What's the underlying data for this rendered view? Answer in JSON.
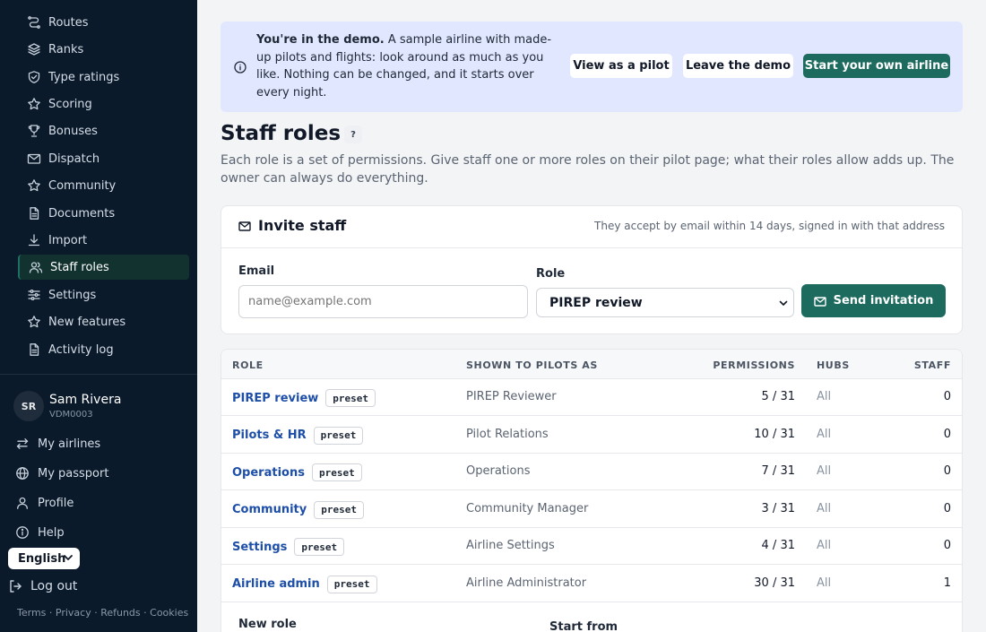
{
  "sidebar": {
    "nav": [
      {
        "label": "Routes",
        "icon": "routes-icon"
      },
      {
        "label": "Ranks",
        "icon": "layers-icon"
      },
      {
        "label": "Type ratings",
        "icon": "shield-icon"
      },
      {
        "label": "Scoring",
        "icon": "star-icon"
      },
      {
        "label": "Bonuses",
        "icon": "trophy-icon"
      },
      {
        "label": "Dispatch",
        "icon": "mail-icon"
      },
      {
        "label": "Community",
        "icon": "star-icon"
      },
      {
        "label": "Documents",
        "icon": "document-icon"
      },
      {
        "label": "Import",
        "icon": "download-icon"
      },
      {
        "label": "Staff roles",
        "icon": "users-icon"
      },
      {
        "label": "Settings",
        "icon": "sliders-icon"
      },
      {
        "label": "New features",
        "icon": "star-icon"
      },
      {
        "label": "Activity log",
        "icon": "document-icon"
      }
    ],
    "active_index": 9,
    "user": {
      "initials": "SR",
      "name": "Sam Rivera",
      "id": "VDM0003"
    },
    "account": [
      {
        "label": "My airlines",
        "icon": "swap-icon"
      },
      {
        "label": "My passport",
        "icon": "globe-icon"
      },
      {
        "label": "Profile",
        "icon": "person-icon"
      },
      {
        "label": "Help",
        "icon": "help-icon"
      }
    ],
    "language": "English",
    "logout": "Log out",
    "footer": "Terms · Privacy · Refunds · Cookies"
  },
  "banner": {
    "bold": "You're in the demo.",
    "text": " A sample airline with made-up pilots and flights: look around as much as you like. Nothing can be changed, and it starts over every night.",
    "buttons": {
      "view_as_pilot": "View as a pilot",
      "leave_demo": "Leave the demo",
      "start_airline": "Start your own airline"
    }
  },
  "page": {
    "title": "Staff roles",
    "help": "?",
    "description": "Each role is a set of permissions. Give staff one or more roles on their pilot page; what their roles allow adds up. The owner can always do everything."
  },
  "invite": {
    "title": "Invite staff",
    "note": "They accept by email within 14 days, signed in with that address",
    "email_label": "Email",
    "email_placeholder": "name@example.com",
    "email_value": "",
    "role_label": "Role",
    "role_selected": "PIREP review",
    "send_label": "Send invitation"
  },
  "roles_table": {
    "headers": {
      "role": "ROLE",
      "shown": "SHOWN TO PILOTS AS",
      "permissions": "PERMISSIONS",
      "hubs": "HUBS",
      "staff": "STAFF"
    },
    "rows": [
      {
        "name": "PIREP review",
        "badge": "preset",
        "shown": "PIREP Reviewer",
        "permissions": "5 / 31",
        "hubs": "All",
        "staff": "0"
      },
      {
        "name": "Pilots & HR",
        "badge": "preset",
        "shown": "Pilot Relations",
        "permissions": "10 / 31",
        "hubs": "All",
        "staff": "0"
      },
      {
        "name": "Operations",
        "badge": "preset",
        "shown": "Operations",
        "permissions": "7 / 31",
        "hubs": "All",
        "staff": "0"
      },
      {
        "name": "Community",
        "badge": "preset",
        "shown": "Community Manager",
        "permissions": "3 / 31",
        "hubs": "All",
        "staff": "0"
      },
      {
        "name": "Settings",
        "badge": "preset",
        "shown": "Airline Settings",
        "permissions": "4 / 31",
        "hubs": "All",
        "staff": "0"
      },
      {
        "name": "Airline admin",
        "badge": "preset",
        "shown": "Airline Administrator",
        "permissions": "30 / 31",
        "hubs": "All",
        "staff": "1"
      }
    ],
    "new_role_label": "New role",
    "start_from_label": "Start from"
  },
  "colors": {
    "sidebar_bg": "#0b1a2a",
    "accent": "#1d6b5f",
    "link": "#1e4fa8",
    "banner_bg": "#e0e7ff"
  }
}
